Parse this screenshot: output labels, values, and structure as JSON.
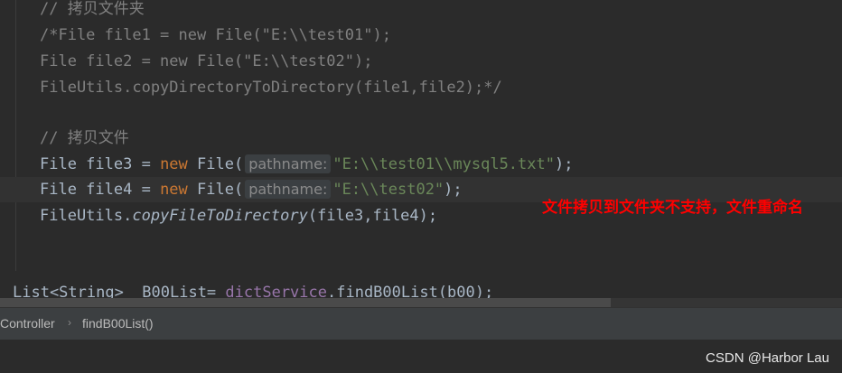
{
  "editor": {
    "lines": {
      "l1": {
        "comment": "// 拷贝文件夹"
      },
      "l2": {
        "comment": "/*File file1 = new File(\"E:\\\\test01\");"
      },
      "l3": {
        "comment": "File file2 = new File(\"E:\\\\test02\");"
      },
      "l4": {
        "comment": "FileUtils.copyDirectoryToDirectory(file1,file2);*/"
      },
      "l5": {
        "comment": "// 拷贝文件"
      },
      "l6": {
        "pre": "File file3 = ",
        "kw": "new",
        "mid": " File(",
        "hint": "pathname:",
        "str": "\"E:\\\\test01\\\\mysql5.txt\"",
        "post": ");"
      },
      "l7": {
        "pre": "File file4 = ",
        "kw": "new",
        "mid": " File(",
        "hint": "pathname:",
        "str": "\"E:\\\\test02\"",
        "post": ");"
      },
      "l8": {
        "pre": "FileUtils.",
        "method": "copyFileToDirectory",
        "post": "(file3,file4);"
      },
      "l9": {
        "pre": "List<String>  B00List= ",
        "field": "dictService",
        "post": ".findB00List(b00);"
      }
    }
  },
  "annotation": {
    "text": "文件拷贝到文件夹不支持，文件重命名"
  },
  "breadcrumb": {
    "items": [
      "Controller",
      "findB00List()"
    ],
    "separator": "›"
  },
  "watermark": "CSDN @Harbor Lau",
  "colors": {
    "background": "#2b2b2b",
    "comment": "#808080",
    "keyword": "#cc7832",
    "string": "#6a8759",
    "annotation": "#ff0000"
  }
}
